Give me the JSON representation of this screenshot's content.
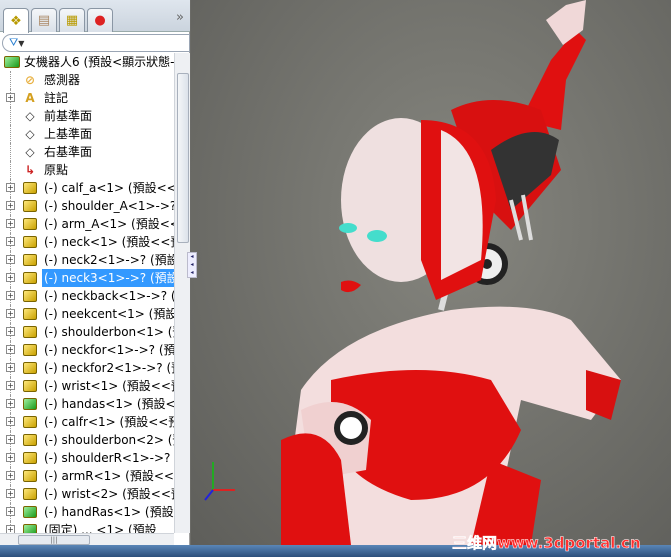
{
  "panel": {
    "tabs": [
      {
        "name": "feature-manager",
        "icon": "assembly-icon"
      },
      {
        "name": "property-manager",
        "icon": "property-icon"
      },
      {
        "name": "configuration-manager",
        "icon": "config-icon"
      },
      {
        "name": "display-manager",
        "icon": "appearance-icon"
      }
    ],
    "more_label": "»",
    "filter_icon": "▼",
    "root": "女機器人6 (預設<顯示狀態-",
    "static_items": [
      "感測器",
      "註記",
      "前基準面",
      "上基準面",
      "右基準面",
      "原點"
    ],
    "components": [
      {
        "label": "(-) calf_a<1> (預設<<預",
        "color": "yellow"
      },
      {
        "label": "(-) shoulder_A<1>->? (",
        "color": "yellow"
      },
      {
        "label": "(-) arm_A<1> (預設<<預",
        "color": "yellow"
      },
      {
        "label": "(-) neck<1> (預設<<預",
        "color": "yellow"
      },
      {
        "label": "(-) neck2<1>->? (預設<",
        "color": "yellow"
      },
      {
        "label": "(-) neck3<1>->? (預設<",
        "color": "yellow",
        "selected": true
      },
      {
        "label": "(-) neckback<1>->? (預",
        "color": "yellow"
      },
      {
        "label": "(-) neekcent<1> (預設<",
        "color": "yellow"
      },
      {
        "label": "(-) shoulderbon<1> (預",
        "color": "yellow"
      },
      {
        "label": "(-) neckfor<1>->? (預設",
        "color": "yellow"
      },
      {
        "label": "(-) neckfor2<1>->? (預",
        "color": "yellow"
      },
      {
        "label": "(-) wrist<1> (預設<<預",
        "color": "yellow"
      },
      {
        "label": "(-) handas<1> (預設<顯",
        "color": "green"
      },
      {
        "label": "(-) calfr<1> (預設<<預",
        "color": "yellow"
      },
      {
        "label": "(-) shoulderbon<2> (預",
        "color": "yellow"
      },
      {
        "label": "(-) shoulderR<1>->? (預",
        "color": "yellow"
      },
      {
        "label": "(-) armR<1> (預設<<預",
        "color": "yellow"
      },
      {
        "label": "(-) wrist<2> (預設<<預",
        "color": "yellow"
      },
      {
        "label": "(-) handRas<1> (預設<",
        "color": "green"
      },
      {
        "label": "(固定) ... <1> (預設",
        "color": "green"
      }
    ]
  },
  "watermark": "三维网www.3dportal.cn",
  "colors": {
    "selection": "#3399ff",
    "robot_red": "#e01010",
    "robot_skin": "#f2dede"
  }
}
